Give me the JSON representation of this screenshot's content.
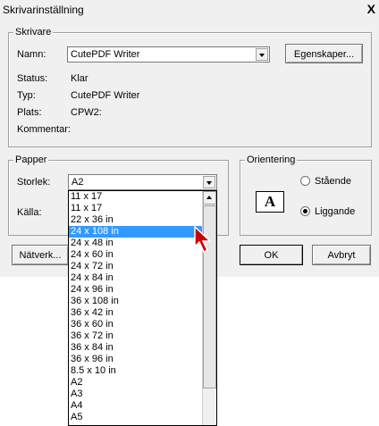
{
  "window": {
    "title": "Skrivarinställning",
    "close": "X"
  },
  "printer": {
    "group": "Skrivare",
    "name_label": "Namn:",
    "name_value": "CutePDF Writer",
    "properties_button": "Egenskaper...",
    "status_label": "Status:",
    "status_value": "Klar",
    "type_label": "Typ:",
    "type_value": "CutePDF Writer",
    "location_label": "Plats:",
    "location_value": "CPW2:",
    "comment_label": "Kommentar:"
  },
  "paper": {
    "group": "Papper",
    "size_label": "Storlek:",
    "size_value": "A2",
    "source_label": "Källa:"
  },
  "orientation": {
    "group": "Orientering",
    "portrait": "Stående",
    "landscape": "Liggande",
    "icon_letter": "A"
  },
  "buttons": {
    "network": "Nätverk...",
    "ok": "OK",
    "cancel": "Avbryt"
  },
  "dropdown": {
    "selected_index": 3,
    "items": [
      "11 x 17",
      "11 x 17",
      "22 x 36 in",
      "24 x 108 in",
      "24 x 48 in",
      "24 x 60 in",
      "24 x 72 in",
      "24 x 84 in",
      "24 x 96 in",
      "36 x 108 in",
      "36 x 42 in",
      "36 x 60 in",
      "36 x 72 in",
      "36 x 84 in",
      "36 x 96 in",
      "8.5 x 10 in",
      "A2",
      "A3",
      "A4",
      "A5"
    ]
  },
  "colors": {
    "selection": "#3399ff",
    "cursor": "#cc0000"
  }
}
